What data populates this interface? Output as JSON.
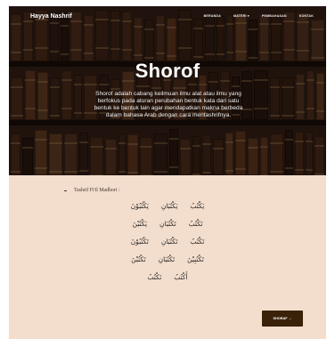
{
  "navbar": {
    "brand": "Hayya Nashrif",
    "links": [
      "BERANDA",
      "MATERI ▾",
      "PEMBAHASAN",
      "KONTAK"
    ]
  },
  "hero": {
    "title": "Shorof",
    "description": "Shorof adalah cabang keilmuan ilmu alat atau ilmu yang berfokus pada aturan perubahan bentuk kata dari satu bentuk ke bentuk lain agar mendapatkan makna berbeda dalam bahasa Arab dengan cara mentashrifnya."
  },
  "tashrif": {
    "label": "Tashrif Fi'il Madhori :",
    "rows": [
      [
        "يَكْتُبُ",
        "يَكْتُبَانِ",
        "يَكْتُبُوْنَ"
      ],
      [
        "تَكْتُبُ",
        "تَكْتُبَانِ",
        "يَكْتُبْنَ"
      ],
      [
        "تَكْتُبُ",
        "تَكْتُبَانِ",
        "تَكْتُبُوْنَ"
      ],
      [
        "تَكْتُبِيْنَ",
        "تَكْتُبَانِ",
        "تَكْتُبْنَ"
      ],
      [
        "أَكْتُبُ",
        "نَكْتُبُ"
      ]
    ]
  },
  "submit": {
    "label": "SHORAF →"
  },
  "footer": {
    "text": ""
  }
}
